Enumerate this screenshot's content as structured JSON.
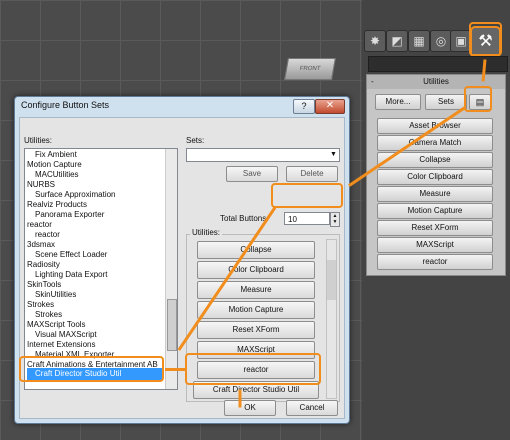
{
  "viewport": {
    "cube_label": "FRONT"
  },
  "command_panel": {
    "tabs": [
      "create-icon",
      "modify-icon",
      "hierarchy-icon",
      "motion-icon",
      "display-icon",
      "utilities-icon"
    ],
    "rollout_title": "Utilities",
    "rollout_minus": "-",
    "more_label": "More...",
    "sets_label": "Sets",
    "buttons": [
      "Asset Browser",
      "Camera Match",
      "Collapse",
      "Color Clipboard",
      "Measure",
      "Motion Capture",
      "Reset XForm",
      "MAXScript",
      "reactor"
    ]
  },
  "dialog": {
    "title": "Configure Button Sets",
    "help_label": "?",
    "close_label": "✕",
    "utilities_label": "Utilities:",
    "sets_label": "Sets:",
    "save_label": "Save",
    "delete_label": "Delete",
    "total_buttons_label": "Total Buttons:",
    "total_buttons_value": "10",
    "group_label": "Utilities:",
    "list_items": [
      "Fix Ambient",
      "Motion Capture",
      "MACUtilities",
      "NURBS",
      "Surface Approximation",
      "Realviz Products",
      "Panorama Exporter",
      "reactor",
      "reactor",
      "3dsmax",
      "Scene Effect Loader",
      "Radiosity",
      "Lighting Data Export",
      "SkinTools",
      "SkinUtilities",
      "Strokes",
      "Strokes",
      "MAXScript Tools",
      "Visual MAXScript",
      "Internet Extensions",
      "Material XML Exporter",
      "Craft Animations & Entertainment AB"
    ],
    "selected_item": "Craft Director Studio Util",
    "group_buttons": [
      "Collapse",
      "Color Clipboard",
      "Measure",
      "Motion Capture",
      "Reset XForm",
      "MAXScript",
      "reactor"
    ],
    "new_button": "Craft Director Studio Util",
    "ok_label": "OK",
    "cancel_label": "Cancel"
  },
  "colors": {
    "highlight": "#f18d1c",
    "selection": "#3399ff"
  }
}
